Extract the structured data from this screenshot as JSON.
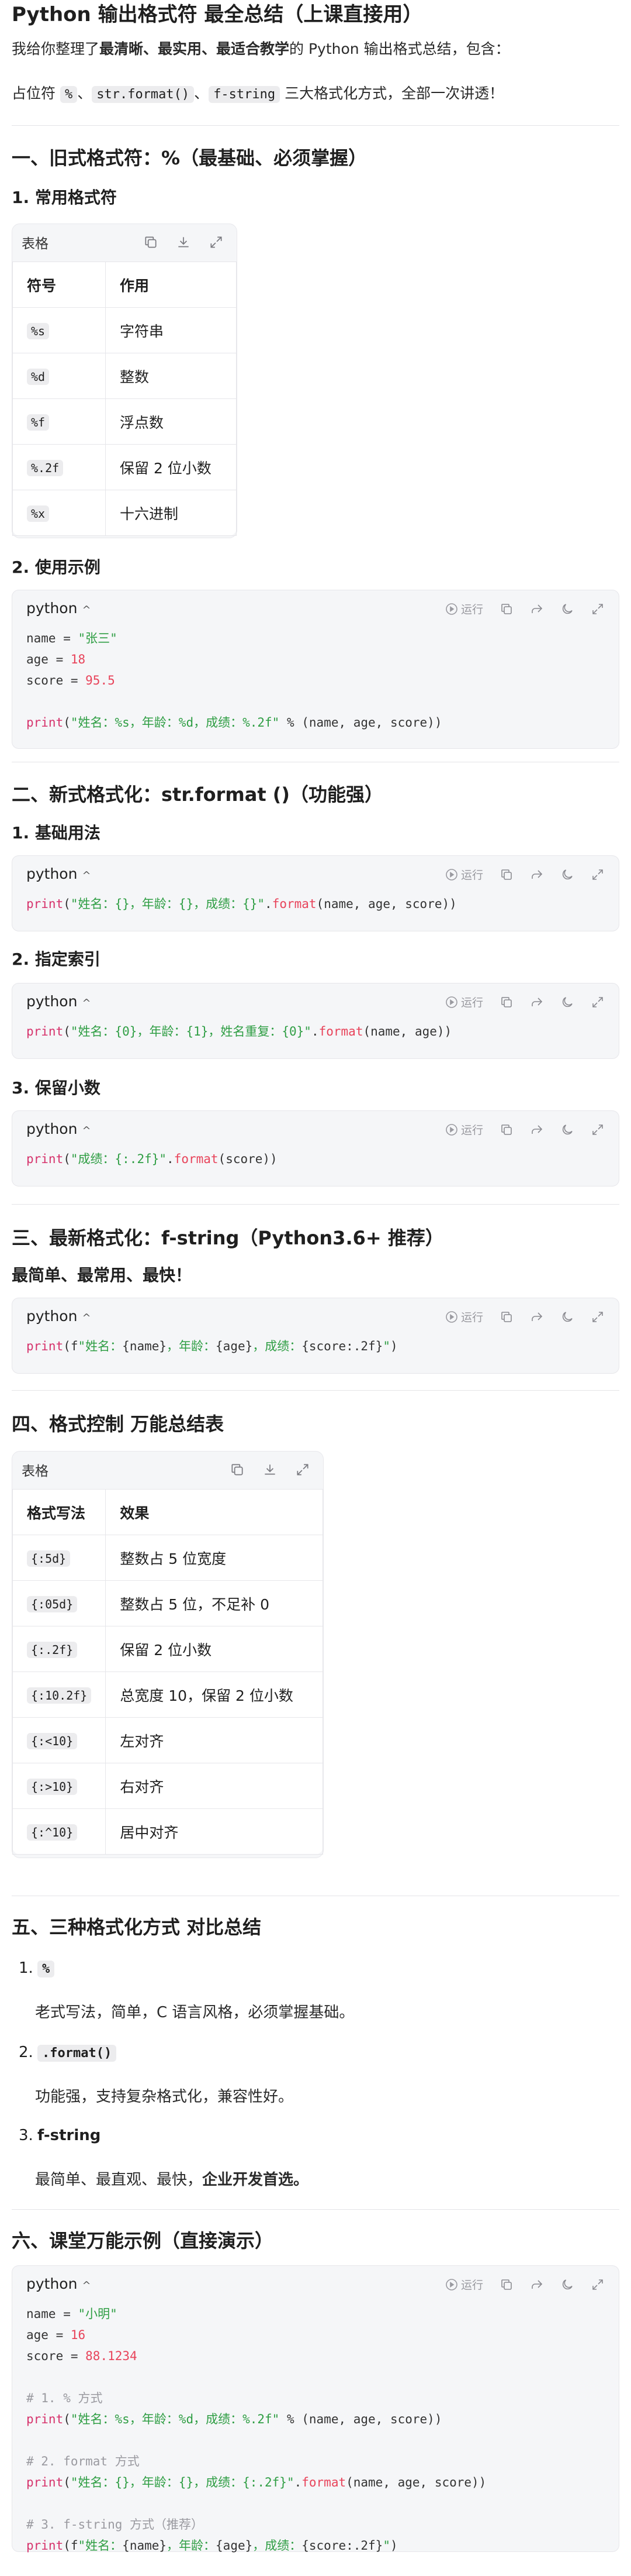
{
  "title": "Python 输出格式符 最全总结（上课直接用）",
  "intro": {
    "prefix": "我给你整理了",
    "bold": "最清晰、最实用、最适合教学",
    "suffix": "的 Python 输出格式总结，包含："
  },
  "intro2": {
    "prefix": "占位符 ",
    "c1": "%",
    "sep1": "、",
    "c2": "str.format()",
    "sep2": "、",
    "c3": "f-string",
    "suffix": " 三大格式化方式，全部一次讲透！"
  },
  "sec1": {
    "heading": "一、旧式格式符：%（最基础、必须掌握）",
    "sub1": "1. 常用格式符",
    "table_label": "表格",
    "table": [
      [
        "符号",
        "作用"
      ],
      [
        "%s",
        "字符串"
      ],
      [
        "%d",
        "整数"
      ],
      [
        "%f",
        "浮点数"
      ],
      [
        "%.2f",
        "保留 2 位小数"
      ],
      [
        "%x",
        "十六进制"
      ]
    ],
    "sub2": "2. 使用示例"
  },
  "code_ui": {
    "lang": "python",
    "chev": "^",
    "run": "运行"
  },
  "code1": {
    "l1": {
      "a": "name = ",
      "b": "\"张三\""
    },
    "l2": {
      "a": "age = ",
      "b": "18"
    },
    "l3": {
      "a": "score = ",
      "b": "95.5"
    },
    "l5": {
      "a": "print",
      "b": "(",
      "c": "\"姓名：%s，年龄：%d，成绩：%.2f\"",
      "d": " % (name, age, score))"
    }
  },
  "sec2": {
    "heading": "二、新式格式化：str.format ()（功能强）",
    "sub1": "1. 基础用法",
    "sub2": "2. 指定索引",
    "sub3": "3. 保留小数"
  },
  "code2": {
    "a": "print",
    "b": "(",
    "c": "\"姓名：{}，年龄：{}，成绩：{}\"",
    "d": ".",
    "e": "format",
    "f": "(name, age, score))"
  },
  "code3": {
    "a": "print",
    "b": "(",
    "c": "\"姓名：{0}，年龄：{1}，姓名重复：{0}\"",
    "d": ".",
    "e": "format",
    "f": "(name, age))"
  },
  "code4": {
    "a": "print",
    "b": "(",
    "c": "\"成绩：{:.2f}\"",
    "d": ".",
    "e": "format",
    "f": "(score))"
  },
  "sec3": {
    "heading": "三、最新格式化：f-string（Python3.6+ 推荐）",
    "sub": "最简单、最常用、最快！"
  },
  "code5": {
    "a": "print",
    "b": "(f",
    "c1": "\"姓名：",
    "v1": "{name}",
    "c2": "，年龄：",
    "v2": "{age}",
    "c3": "，成绩：",
    "v3": "{score:.2f}",
    "c4": "\"",
    "d": ")"
  },
  "sec4": {
    "heading": "四、格式控制 万能总结表",
    "table_label": "表格",
    "table": [
      [
        "格式写法",
        "效果"
      ],
      [
        "{:5d}",
        "整数占 5 位宽度"
      ],
      [
        "{:05d}",
        "整数占 5 位，不足补 0"
      ],
      [
        "{:.2f}",
        "保留 2 位小数"
      ],
      [
        "{:10.2f}",
        "总宽度 10，保留 2 位小数"
      ],
      [
        "{:<10}",
        "左对齐"
      ],
      [
        "{:>10}",
        "右对齐"
      ],
      [
        "{:^10}",
        "居中对齐"
      ]
    ]
  },
  "sec5": {
    "heading": "五、三种格式化方式 对比总结",
    "items": [
      {
        "num": "1.",
        "head": "%",
        "text": "老式写法，简单，C 语言风格，必须掌握基础。"
      },
      {
        "num": "2.",
        "head": ".format()",
        "text": "功能强，支持复杂格式化，兼容性好。"
      },
      {
        "num": "3.",
        "head": "f-string",
        "text_prefix": "最简单、最直观、最快，",
        "text_bold": "企业开发首选。"
      }
    ]
  },
  "sec6": {
    "heading": "六、课堂万能示例（直接演示）"
  },
  "code6": {
    "l1": {
      "a": "name = ",
      "b": "\"小明\""
    },
    "l2": {
      "a": "age = ",
      "b": "16"
    },
    "l3": {
      "a": "score = ",
      "b": "88.1234"
    },
    "c1": "# 1. % 方式",
    "p1": {
      "a": "print",
      "b": "(",
      "c": "\"姓名：%s，年龄：%d，成绩：%.2f\"",
      "d": " % (name, age, score))"
    },
    "c2": "# 2. format 方式",
    "p2": {
      "a": "print",
      "b": "(",
      "c": "\"姓名：{}，年龄：{}，成绩：{:.2f}\"",
      "d": ".",
      "e": "format",
      "f": "(name, age, score))"
    },
    "c3": "# 3. f-string 方式（推荐）",
    "p3": {
      "a": "print",
      "b": "(f",
      "c1": "\"姓名：",
      "v1": "{name}",
      "c2": "，年龄：",
      "v2": "{age}",
      "c3": "，成绩：",
      "v3": "{score:.2f}",
      "c4": "\"",
      "d": ")"
    }
  }
}
